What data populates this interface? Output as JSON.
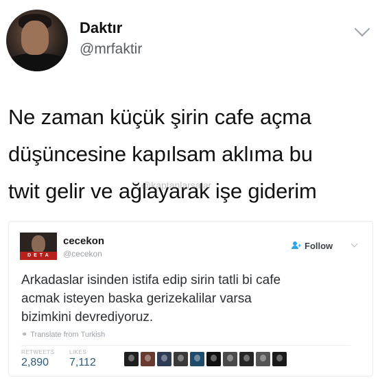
{
  "tweet": {
    "display_name": "Daktır",
    "handle": "@mrfaktir",
    "text_lines": [
      "Ne zaman küçük şirin cafe açma",
      "düşüncesine kapılsam aklıma bu",
      "twit gelir ve ağlayarak işe giderim"
    ],
    "watermark": "@kaptanlarsalar"
  },
  "quoted": {
    "display_name": "cecekon",
    "handle": "@cecekon",
    "avatar_banner": "D E T A",
    "follow_label": "Follow",
    "text_lines": [
      "Arkadaslar isinden istifa edip sirin tatli bi cafe",
      "acmak isteyen baska gerizekalilar varsa",
      "bizimkini devrediyoruz."
    ],
    "translate_label": "Translate from Turkish",
    "retweets_label": "RETWEETS",
    "retweets_value": "2,890",
    "likes_label": "LIKES",
    "likes_value": "7,112",
    "likers": [
      {
        "color": "#1e1e1e"
      },
      {
        "color": "#6b3a2e"
      },
      {
        "color": "#2d3b55"
      },
      {
        "color": "#3a3a3a"
      },
      {
        "color": "#1f4c6b"
      },
      {
        "color": "#101010"
      },
      {
        "color": "#4a4a4a"
      },
      {
        "color": "#262626"
      },
      {
        "color": "#555555"
      },
      {
        "color": "#1a1a1a"
      }
    ]
  }
}
